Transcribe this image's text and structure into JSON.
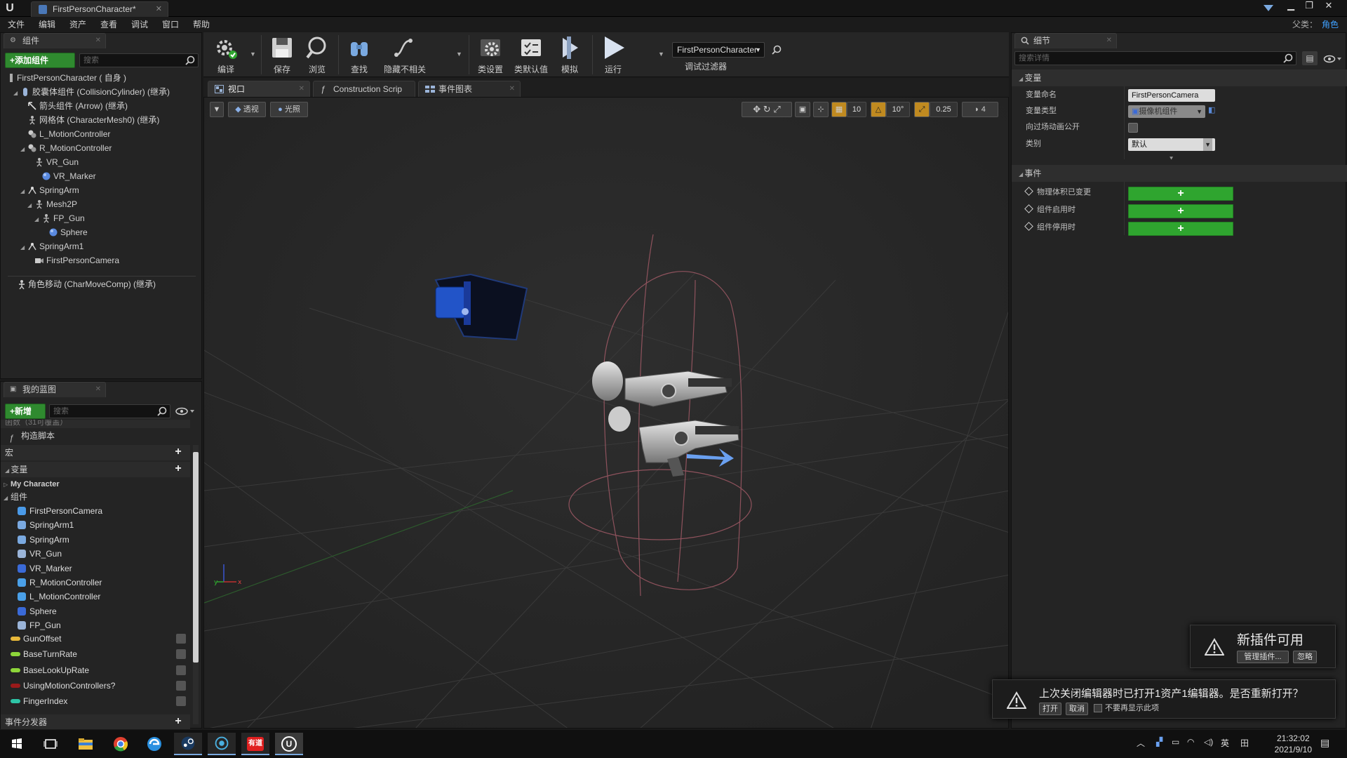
{
  "window": {
    "tab_title": "FirstPersonCharacter*",
    "parent_class_label": "父类：",
    "parent_class_value": "角色"
  },
  "menu": [
    "文件",
    "编辑",
    "资产",
    "查看",
    "调试",
    "窗口",
    "帮助"
  ],
  "components_panel": {
    "tab_label": "组件",
    "add_button": "+添加组件",
    "search_placeholder": "搜索",
    "root": "FirstPersonCharacter ( 自身 )",
    "tree": [
      {
        "label": "胶囊体组件 (CollisionCylinder) (继承)",
        "indent": 1,
        "icon": "capsule"
      },
      {
        "label": "箭头组件 (Arrow) (继承)",
        "indent": 2,
        "icon": "arrow"
      },
      {
        "label": "网格体 (CharacterMesh0) (继承)",
        "indent": 2,
        "icon": "mesh"
      },
      {
        "label": "L_MotionController",
        "indent": 2,
        "icon": "motion"
      },
      {
        "label": "R_MotionController",
        "indent": 2,
        "icon": "motion"
      },
      {
        "label": "VR_Gun",
        "indent": 3,
        "icon": "mesh"
      },
      {
        "label": "VR_Marker",
        "indent": 4,
        "icon": "sphere"
      },
      {
        "label": "SpringArm",
        "indent": 2,
        "icon": "spring"
      },
      {
        "label": "Mesh2P",
        "indent": 3,
        "icon": "mesh"
      },
      {
        "label": "FP_Gun",
        "indent": 4,
        "icon": "mesh"
      },
      {
        "label": "Sphere",
        "indent": 5,
        "icon": "sphere"
      },
      {
        "label": "SpringArm1",
        "indent": 2,
        "icon": "spring"
      },
      {
        "label": "FirstPersonCamera",
        "indent": 3,
        "icon": "camera"
      }
    ],
    "movement": "角色移动 (CharMoveComp) (继承)"
  },
  "blueprint_panel": {
    "tab_label": "我的蓝图",
    "new_button": "+新增",
    "search_placeholder": "搜索",
    "functions_header": "函数（31可覆盖）",
    "construction_script": "构造脚本",
    "macros_header": "宏",
    "variables_header": "变量",
    "my_character": "My Character",
    "components_header": "组件",
    "component_vars": [
      "FirstPersonCamera",
      "SpringArm1",
      "SpringArm",
      "VR_Gun",
      "VR_Marker",
      "R_MotionController",
      "L_MotionController",
      "Sphere",
      "FP_Gun"
    ],
    "variables": [
      {
        "name": "GunOffset",
        "color": "#e8b83a"
      },
      {
        "name": "BaseTurnRate",
        "color": "#8ed63a"
      },
      {
        "name": "BaseLookUpRate",
        "color": "#8ed63a"
      },
      {
        "name": "UsingMotionControllers?",
        "color": "#9a1a1a"
      },
      {
        "name": "FingerIndex",
        "color": "#2ec4a6"
      }
    ],
    "dispatchers_header": "事件分发器"
  },
  "toolbar": {
    "compile": "编译",
    "save": "保存",
    "browse": "浏览",
    "find": "查找",
    "hide_unrelated": "隐藏不相关",
    "class_settings": "类设置",
    "class_defaults": "类默认值",
    "simulate": "模拟",
    "play": "运行",
    "debug_object": "FirstPersonCharacter",
    "debug_filter": "调试过滤器"
  },
  "center_tabs": {
    "viewport": "视口",
    "construction": "Construction Scrip",
    "event_graph": "事件图表"
  },
  "viewport": {
    "perspective": "透视",
    "lit": "光照",
    "grid_snap": "10",
    "rot_snap": "10°",
    "scale_snap": "0.25",
    "cam_speed": "4"
  },
  "details_panel": {
    "tab_label": "细节",
    "search_placeholder": "搜索详情",
    "variables_section": "变量",
    "var_name_label": "变量命名",
    "var_name_value": "FirstPersonCamera",
    "var_type_label": "变量类型",
    "var_type_value": "摄像机组件",
    "expose_label": "向过场动画公开",
    "category_label": "类别",
    "category_value": "默认",
    "events_section": "事件",
    "events": [
      "物理体积已变更",
      "组件启用时",
      "组件停用时"
    ]
  },
  "notifications": {
    "plugin_title": "新插件可用",
    "manage_plugins": "管理插件...",
    "ignore": "忽略",
    "reopen_message": "上次关闭编辑器时已打开1资产1编辑器。是否重新打开？",
    "open": "打开",
    "cancel": "取消",
    "dont_show": "不要再显示此项"
  },
  "taskbar": {
    "ime": "英",
    "time": "21:32:02",
    "date": "2021/9/10",
    "app_label": "有道"
  }
}
